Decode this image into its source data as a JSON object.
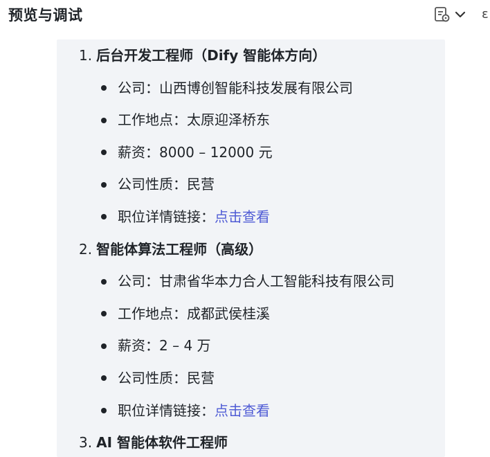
{
  "header": {
    "title": "预览与调试",
    "clipped_glyph": "ε"
  },
  "jobs": [
    {
      "number": "1.",
      "title": "后台开发工程师（Dify 智能体方向）",
      "details": [
        {
          "label": "公司：",
          "value": "山西博创智能科技发展有限公司"
        },
        {
          "label": "工作地点：",
          "value": "太原迎泽桥东"
        },
        {
          "label": "薪资：",
          "value": "8000 – 12000 元"
        },
        {
          "label": "公司性质：",
          "value": "民营"
        },
        {
          "label": "职位详情链接：",
          "link": "点击查看"
        }
      ]
    },
    {
      "number": "2.",
      "title": "智能体算法工程师（高级）",
      "details": [
        {
          "label": "公司：",
          "value": "甘肃省华本力合人工智能科技有限公司"
        },
        {
          "label": "工作地点：",
          "value": "成都武侯桂溪"
        },
        {
          "label": "薪资：",
          "value": "2 – 4 万"
        },
        {
          "label": "公司性质：",
          "value": "民营"
        },
        {
          "label": "职位详情链接：",
          "link": "点击查看"
        }
      ]
    },
    {
      "number": "3.",
      "title": "AI 智能体软件工程师",
      "details": []
    }
  ],
  "colors": {
    "link": "#4f5bd5",
    "panel_bg": "#f2f4f7",
    "text": "#1f2328"
  },
  "icons": [
    "document-settings-icon",
    "chevron-down-icon",
    "bullet-icon"
  ]
}
